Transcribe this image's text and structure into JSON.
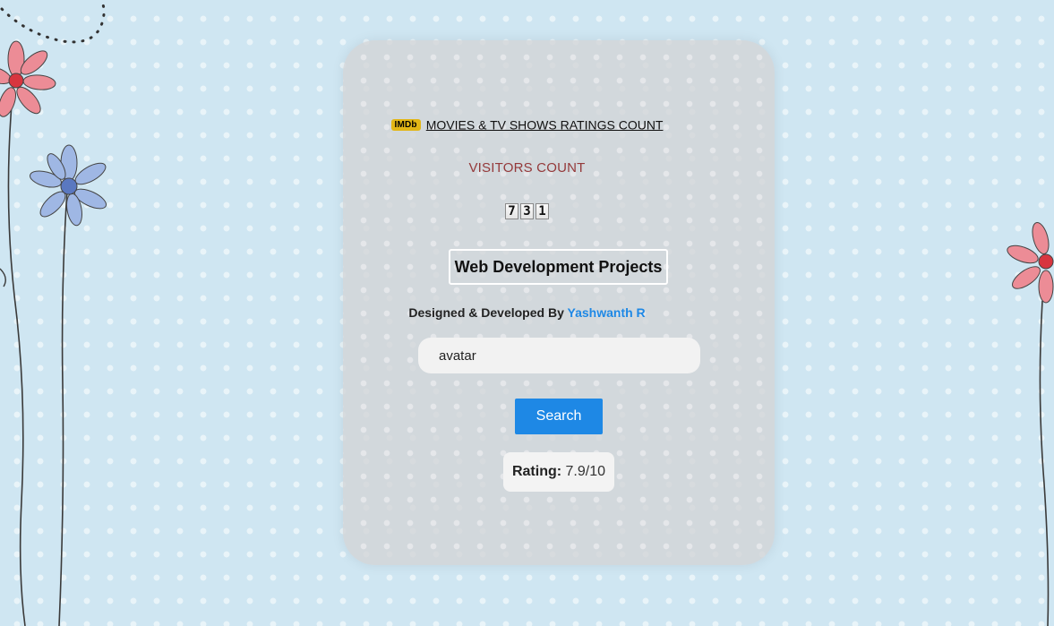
{
  "imdb": {
    "logo_text": "IMDb",
    "link_text": "MOVIES & TV SHOWS RATINGS COUNT",
    "logo_color": "#e2b616"
  },
  "visitors": {
    "label": "VISITORS COUNT",
    "digits": [
      "7",
      "3",
      "1"
    ],
    "label_color": "#94393a"
  },
  "projects": {
    "title": "Web Development Projects"
  },
  "credit": {
    "prefix": "Designed & Developed By",
    "author": "Yashwanth R",
    "author_color": "#1e88e5"
  },
  "search": {
    "value": "avatar",
    "button_label": "Search",
    "button_color": "#1e88e5"
  },
  "rating": {
    "label": "Rating:",
    "value": "7.9/10"
  }
}
